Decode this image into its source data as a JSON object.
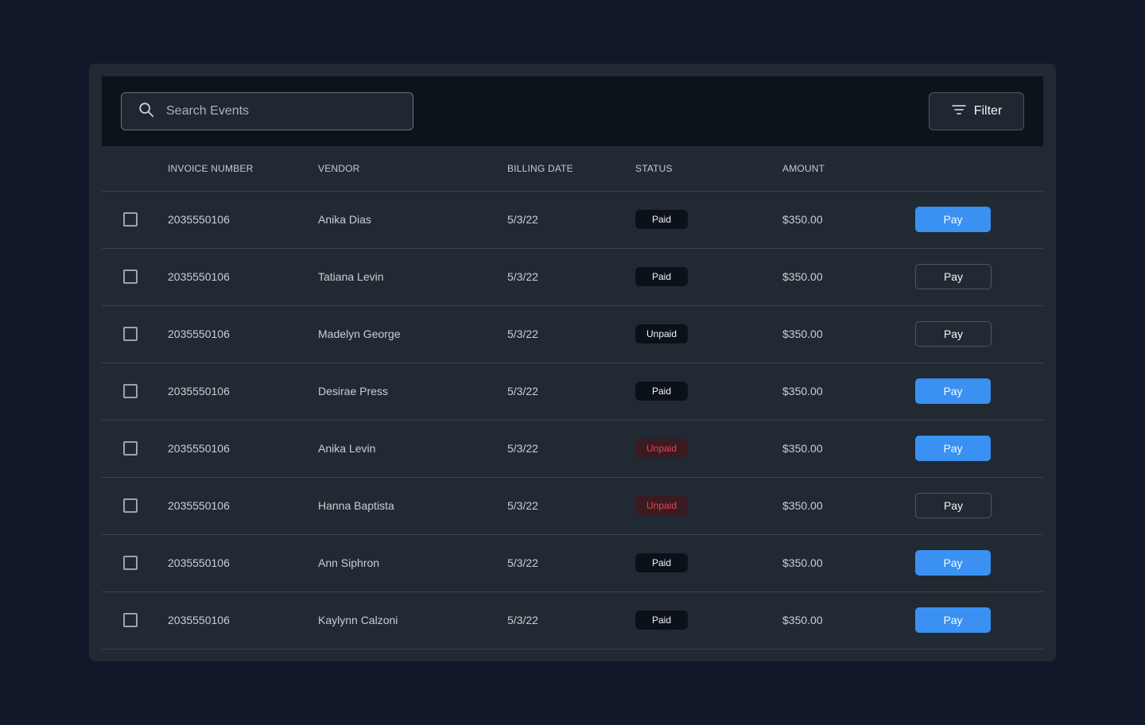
{
  "search": {
    "placeholder": "Search Events"
  },
  "filter": {
    "label": "Filter"
  },
  "table": {
    "headers": [
      "INVOICE NUMBER",
      "VENDOR",
      "BILLING DATE",
      "STATUS",
      "AMOUNT"
    ],
    "pay_label": "Pay",
    "rows": [
      {
        "invoice": "2035550106",
        "vendor": "Anika Dias",
        "date": "5/3/22",
        "status": "Paid",
        "status_tone": "dark",
        "amount": "$350.00",
        "pay_style": "primary"
      },
      {
        "invoice": "2035550106",
        "vendor": "Tatiana Levin",
        "date": "5/3/22",
        "status": "Paid",
        "status_tone": "dark",
        "amount": "$350.00",
        "pay_style": "outline"
      },
      {
        "invoice": "2035550106",
        "vendor": "Madelyn George",
        "date": "5/3/22",
        "status": "Unpaid",
        "status_tone": "dark",
        "amount": "$350.00",
        "pay_style": "outline"
      },
      {
        "invoice": "2035550106",
        "vendor": "Desirae Press",
        "date": "5/3/22",
        "status": "Paid",
        "status_tone": "dark",
        "amount": "$350.00",
        "pay_style": "primary"
      },
      {
        "invoice": "2035550106",
        "vendor": "Anika Levin",
        "date": "5/3/22",
        "status": "Unpaid",
        "status_tone": "red",
        "amount": "$350.00",
        "pay_style": "primary"
      },
      {
        "invoice": "2035550106",
        "vendor": "Hanna Baptista",
        "date": "5/3/22",
        "status": "Unpaid",
        "status_tone": "red",
        "amount": "$350.00",
        "pay_style": "outline"
      },
      {
        "invoice": "2035550106",
        "vendor": "Ann Siphron",
        "date": "5/3/22",
        "status": "Paid",
        "status_tone": "dark",
        "amount": "$350.00",
        "pay_style": "primary"
      },
      {
        "invoice": "2035550106",
        "vendor": "Kaylynn Calzoni",
        "date": "5/3/22",
        "status": "Paid",
        "status_tone": "dark",
        "amount": "$350.00",
        "pay_style": "primary"
      }
    ]
  },
  "colors": {
    "background": "#111827",
    "card": "#212a32",
    "toolbar": "#0d131b",
    "primary": "#3b91f2",
    "unpaid_red": "#e5484d"
  },
  "icons": {
    "search": "search-icon",
    "filter": "filter-icon"
  }
}
